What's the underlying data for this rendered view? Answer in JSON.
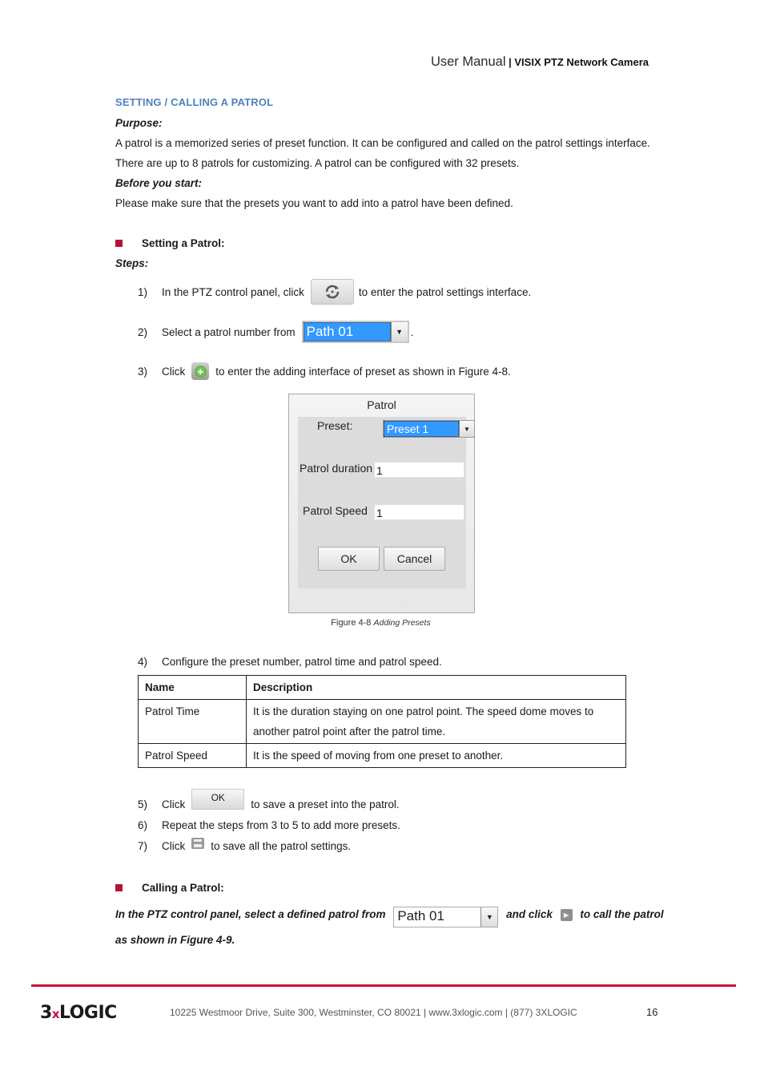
{
  "header": {
    "doc_title": "User Manual",
    "separator": " | ",
    "product_name": "VISIX PTZ Network Camera"
  },
  "section": {
    "title": "SETTING / CALLING A PATROL",
    "purpose_label": "Purpose:",
    "purpose_text": "A patrol is a memorized series of preset function. It can be configured and called on the patrol settings interface. There are up to 8 patrols for customizing. A patrol can be configured with 32 presets.",
    "before_label": "Before you start:",
    "before_text": "Please make sure that the presets you want to add into a patrol have been defined."
  },
  "setting": {
    "bullet_title": "Setting a Patrol:",
    "steps_label": "Steps:",
    "steps": [
      {
        "num": "1)",
        "before": "In the PTZ control panel, click",
        "after": "to enter the patrol settings interface."
      },
      {
        "num": "2)",
        "before": "Select a patrol number from",
        "after": "."
      },
      {
        "num": "3)",
        "before": "Click",
        "after": "to enter the adding interface of preset as shown in Figure 4-8."
      },
      {
        "num": "4)",
        "before": "Configure the preset number, patrol time and patrol speed.",
        "after": ""
      },
      {
        "num": "5)",
        "before": "Click",
        "after": "to save a preset into the patrol."
      },
      {
        "num": "6)",
        "before": "Repeat the steps from 3 to 5 to add more presets.",
        "after": ""
      },
      {
        "num": "7)",
        "before": "Click",
        "after": "to save all the patrol settings."
      }
    ],
    "path_select_value": "Path 01",
    "ok_button_label": "OK",
    "icons": {
      "patrol": "patrol-cycle-icon",
      "add": "add-preset-icon",
      "save": "save-icon",
      "dropdown": "chevron-down-icon"
    }
  },
  "dialog": {
    "title": "Patrol",
    "preset_label": "Preset:",
    "preset_value": "Preset 1",
    "duration_label": "Patrol duration",
    "duration_value": "1",
    "speed_label": "Patrol Speed",
    "speed_value": "1",
    "ok_label": "OK",
    "cancel_label": "Cancel"
  },
  "figure": {
    "number": "Figure 4-8",
    "caption": "Adding Presets"
  },
  "table": {
    "headers": [
      "Name",
      "Description"
    ],
    "rows": [
      [
        "Patrol Time",
        "It is the duration staying on one patrol point. The speed dome moves to another patrol point after the patrol time."
      ],
      [
        "Patrol Speed",
        "It is the speed of moving from one preset to another."
      ]
    ]
  },
  "calling": {
    "bullet_title": "Calling a Patrol:",
    "text_before": "In the PTZ control panel, select a defined patrol from",
    "path_select_value": "Path 01",
    "text_middle": "and click",
    "text_after": "to call the patrol as shown in Figure 4-9.",
    "icon": "play-icon"
  },
  "footer": {
    "logo_prefix": "3",
    "logo_x": "x",
    "logo_suffix": "LOGIC",
    "address": "10225 Westmoor Drive, Suite 300, Westminster, CO 80021 | www.3xlogic.com | (877) 3XLOGIC",
    "page_number": "16",
    "accent_color": "#c8103e"
  }
}
